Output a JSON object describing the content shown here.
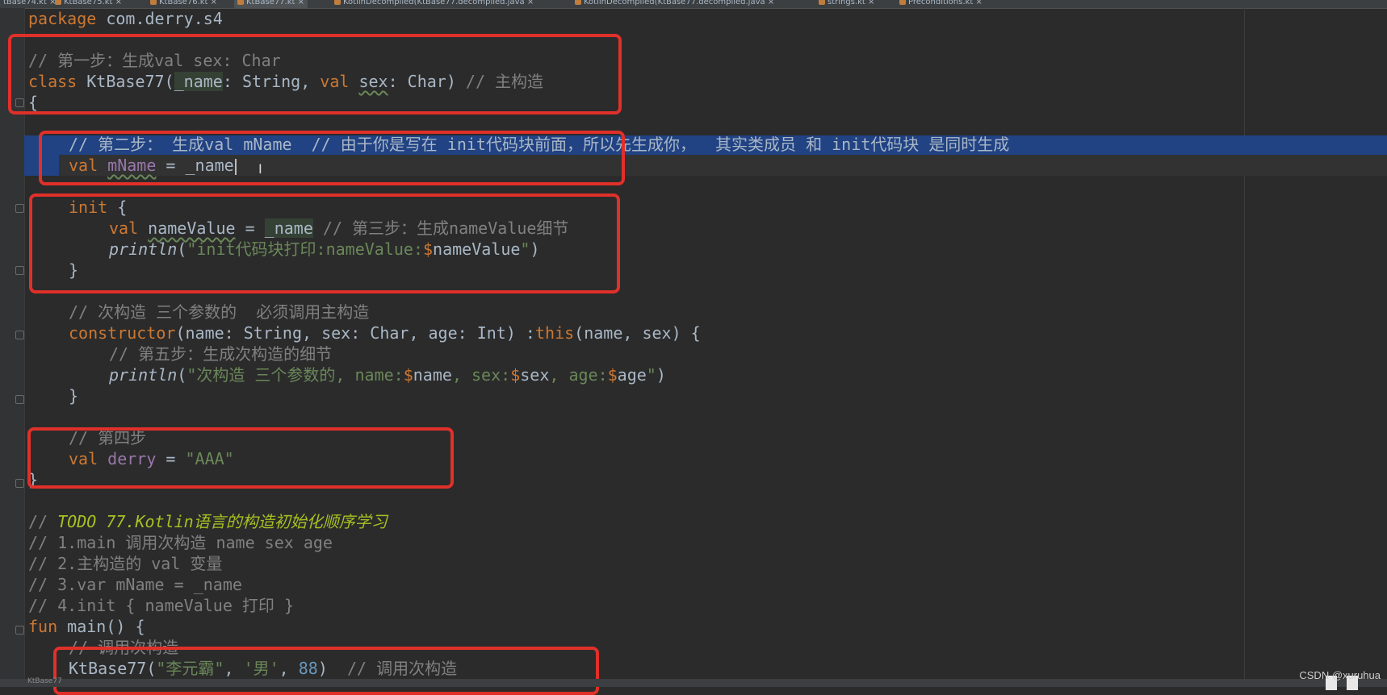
{
  "tabs": [
    {
      "label": "tBase74.kt",
      "active": false
    },
    {
      "label": "KtBase75.kt",
      "active": false
    },
    {
      "label": "KtBase76.kt",
      "active": false
    },
    {
      "label": "KtBase77.kt",
      "active": true
    },
    {
      "label": "KotlinDecompiled(KtBase77.decompiled.java",
      "active": false
    },
    {
      "label": "KotlinDecompiled(KtBase77.decompiled.java",
      "active": false
    },
    {
      "label": "strings.kt",
      "active": false
    },
    {
      "label": "Preconditions.kt",
      "active": false
    }
  ],
  "code": {
    "l1": {
      "kw": "package",
      "rest": " com.derry.s4"
    },
    "l2": {
      "comment": "// 第一步：生成val sex: Char"
    },
    "l3": {
      "kw1": "class",
      "a": " KtBase77(",
      "p1": "_name",
      "b": ": String, ",
      "kw2": "val",
      "c": " ",
      "p2": "sex",
      "d": ": Char) ",
      "comment": "// 主构造"
    },
    "l4": {
      "text": "{"
    },
    "l5": {
      "comment": "// 第二步： 生成val mName  // 由于你是写在 init代码块前面，所以先生成你，  其实类成员 和 init代码块 是同时生成"
    },
    "l6": {
      "kw": "val",
      "a": " ",
      "p": "mName",
      "b": " = _name"
    },
    "l7": {
      "kw": "init",
      "a": " {"
    },
    "l8": {
      "kw": "val",
      "a": " ",
      "p": "nameValue",
      "b": " = ",
      "c": "_name",
      "comment": " // 第三步：生成nameValue细节"
    },
    "l9": {
      "fn": "println",
      "a": "(",
      "s1": "\"init代码块打印:nameValue:",
      "d": "$",
      "v": "nameValue",
      "s2": "\"",
      "b": ")"
    },
    "l10": {
      "text": "}"
    },
    "l11": {
      "comment": "// 次构造 三个参数的  必须调用主构造"
    },
    "l12": {
      "kw": "constructor",
      "a": "(name: String, sex: Char, age: Int) :",
      "kw2": "this",
      "b": "(name, sex) {"
    },
    "l13": {
      "comment": "// 第五步：生成次构造的细节"
    },
    "l14": {
      "fn": "println",
      "a": "(",
      "s1": "\"次构造 三个参数的, name:",
      "d1": "$",
      "v1": "name",
      "s2": ", sex:",
      "d2": "$",
      "v2": "sex",
      "s3": ", age:",
      "d3": "$",
      "v3": "age",
      "s4": "\"",
      "b": ")"
    },
    "l15": {
      "text": "}"
    },
    "l16": {
      "comment": "// 第四步"
    },
    "l17": {
      "kw": "val",
      "a": " ",
      "p": "derry",
      "b": " = ",
      "s": "\"AAA\""
    },
    "l18": {
      "text": "}"
    },
    "l19": {
      "c1": "// ",
      "todo": "TODO 77.Kotlin语言的构造初始化顺序学习"
    },
    "l20": {
      "comment": "// 1.main 调用次构造 name sex age"
    },
    "l21": {
      "comment": "// 2.主构造的 val 变量"
    },
    "l22": {
      "comment": "// 3.var mName = _name"
    },
    "l23": {
      "comment": "// 4.init { nameValue 打印 }"
    },
    "l24": {
      "kw": "fun",
      "a": " main() {"
    },
    "l25": {
      "comment": "// 调用次构造"
    },
    "l26": {
      "a": "KtBase77(",
      "s1": "\"李元霸\"",
      "b": ", ",
      "s2": "'男'",
      "c": ", ",
      "n": "88",
      "d": ")  ",
      "comment": "// 调用次构造"
    }
  },
  "status": {
    "file": "KtBase77"
  },
  "watermark": "CSDN @xuruhua",
  "colors": {
    "annotation_box": "#e0302a",
    "selection": "#214283",
    "keyword": "#cc7832",
    "comment": "#808080",
    "string": "#6a8759"
  }
}
